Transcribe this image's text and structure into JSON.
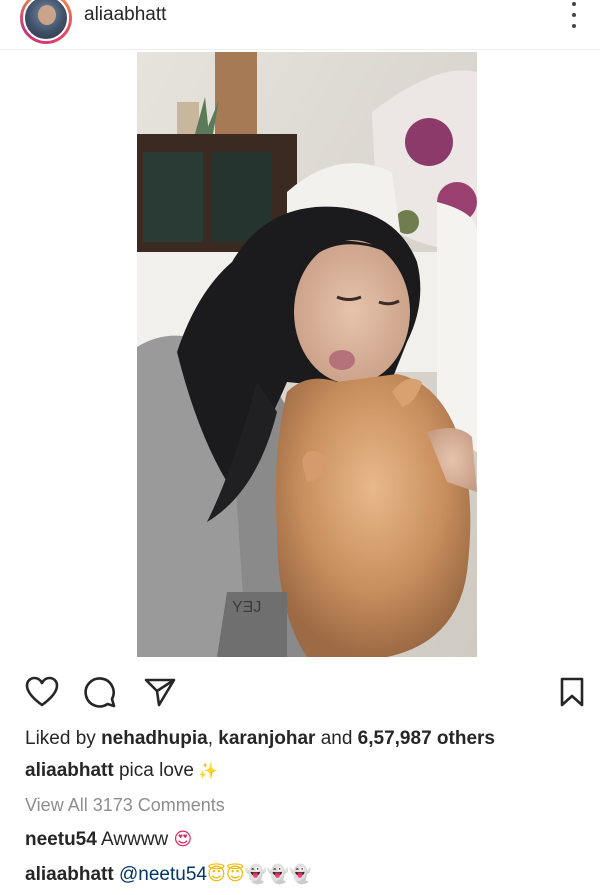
{
  "post": {
    "username": "aliaabhatt",
    "likes": {
      "prefix": "Liked by",
      "user1": "nehadhupia",
      "separator": ",",
      "user2": "karanjohar",
      "and": "and",
      "count": "6,57,987 others"
    },
    "caption": {
      "username": "aliaabhatt",
      "text": "pica love",
      "emoji": "✨"
    },
    "view_all_comments": "View All 3173 Comments",
    "comments": [
      {
        "username": "neetu54",
        "text": "Awwww",
        "emoji": "😍"
      },
      {
        "username": "aliaabhatt",
        "mention": "@neetu54",
        "emoji_halo": "😇😇",
        "emoji_ghosts": "👻👻👻"
      }
    ]
  },
  "icons": {
    "more": "more-options-icon",
    "like": "heart-icon",
    "comment": "comment-icon",
    "share": "share-icon",
    "save": "bookmark-icon"
  },
  "colors": {
    "text": "#262626",
    "muted": "#8e8e8e",
    "mention": "#003569",
    "border": "#efefef"
  }
}
